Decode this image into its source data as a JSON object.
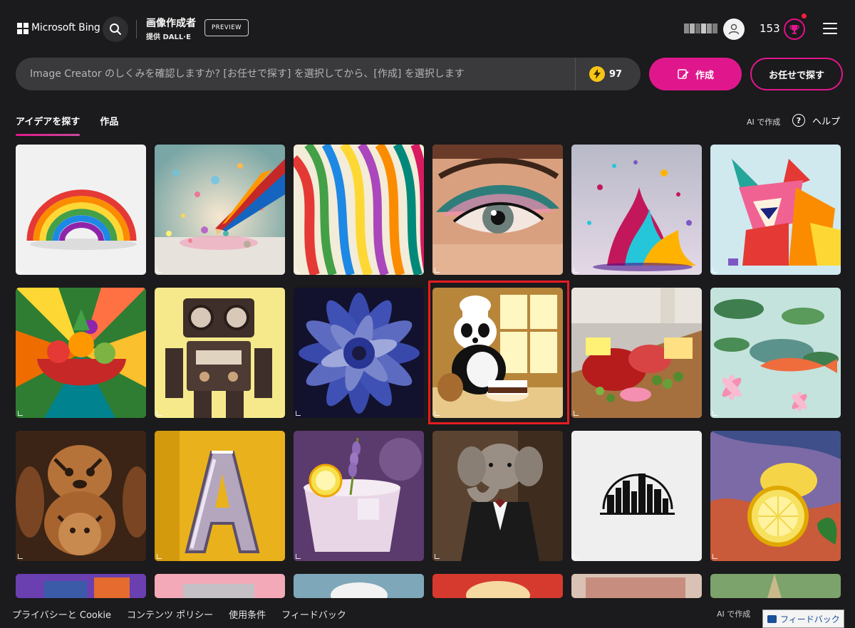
{
  "header": {
    "brand": "Microsoft Bing",
    "app_title": "画像作成者",
    "app_subtitle": "提供 DALL·E",
    "preview_badge": "PREVIEW",
    "points": "153",
    "icons": {
      "search": "search-icon",
      "avatar": "user-avatar-icon",
      "rewards": "trophy-icon",
      "menu": "hamburger-menu-icon"
    }
  },
  "prompt": {
    "placeholder": "Image Creator のしくみを確認しますか? [お任せで探す] を選択してから、[作成] を選択します",
    "value": "",
    "boosts": "97",
    "create_label": "作成",
    "surprise_label": "お任せで探す"
  },
  "tabs": [
    {
      "label": "アイデアを探す",
      "active": true
    },
    {
      "label": "作品",
      "active": false
    }
  ],
  "right_links": {
    "ai_create": "AI で作成",
    "help": "ヘルプ",
    "help_glyph": "?"
  },
  "gallery": [
    {
      "name": "rainbow-paper-art"
    },
    {
      "name": "pencil-glitter"
    },
    {
      "name": "colorful-ribbons"
    },
    {
      "name": "eye-makeup"
    },
    {
      "name": "paint-splash"
    },
    {
      "name": "paper-wolf"
    },
    {
      "name": "fruit-bowl"
    },
    {
      "name": "retro-robot"
    },
    {
      "name": "blue-dahlia"
    },
    {
      "name": "panda-chef",
      "highlighted": true
    },
    {
      "name": "charcuterie-board"
    },
    {
      "name": "koi-pond"
    },
    {
      "name": "tiger-figurines"
    },
    {
      "name": "chrome-letter-a"
    },
    {
      "name": "lavender-cocktail"
    },
    {
      "name": "elephant-suit"
    },
    {
      "name": "city-skyline-logo"
    },
    {
      "name": "lemon-painting"
    }
  ],
  "footer": {
    "links": [
      "プライバシーと Cookie",
      "コンテンツ ポリシー",
      "使用条件",
      "フィードバック"
    ],
    "ai_create": "AI で作成",
    "feedback_button": "フィードバック"
  },
  "colors": {
    "background": "#1b1a1c",
    "accent": "#e0178c",
    "highlight_border": "#e61c23",
    "boost_coin": "#f5c518"
  }
}
